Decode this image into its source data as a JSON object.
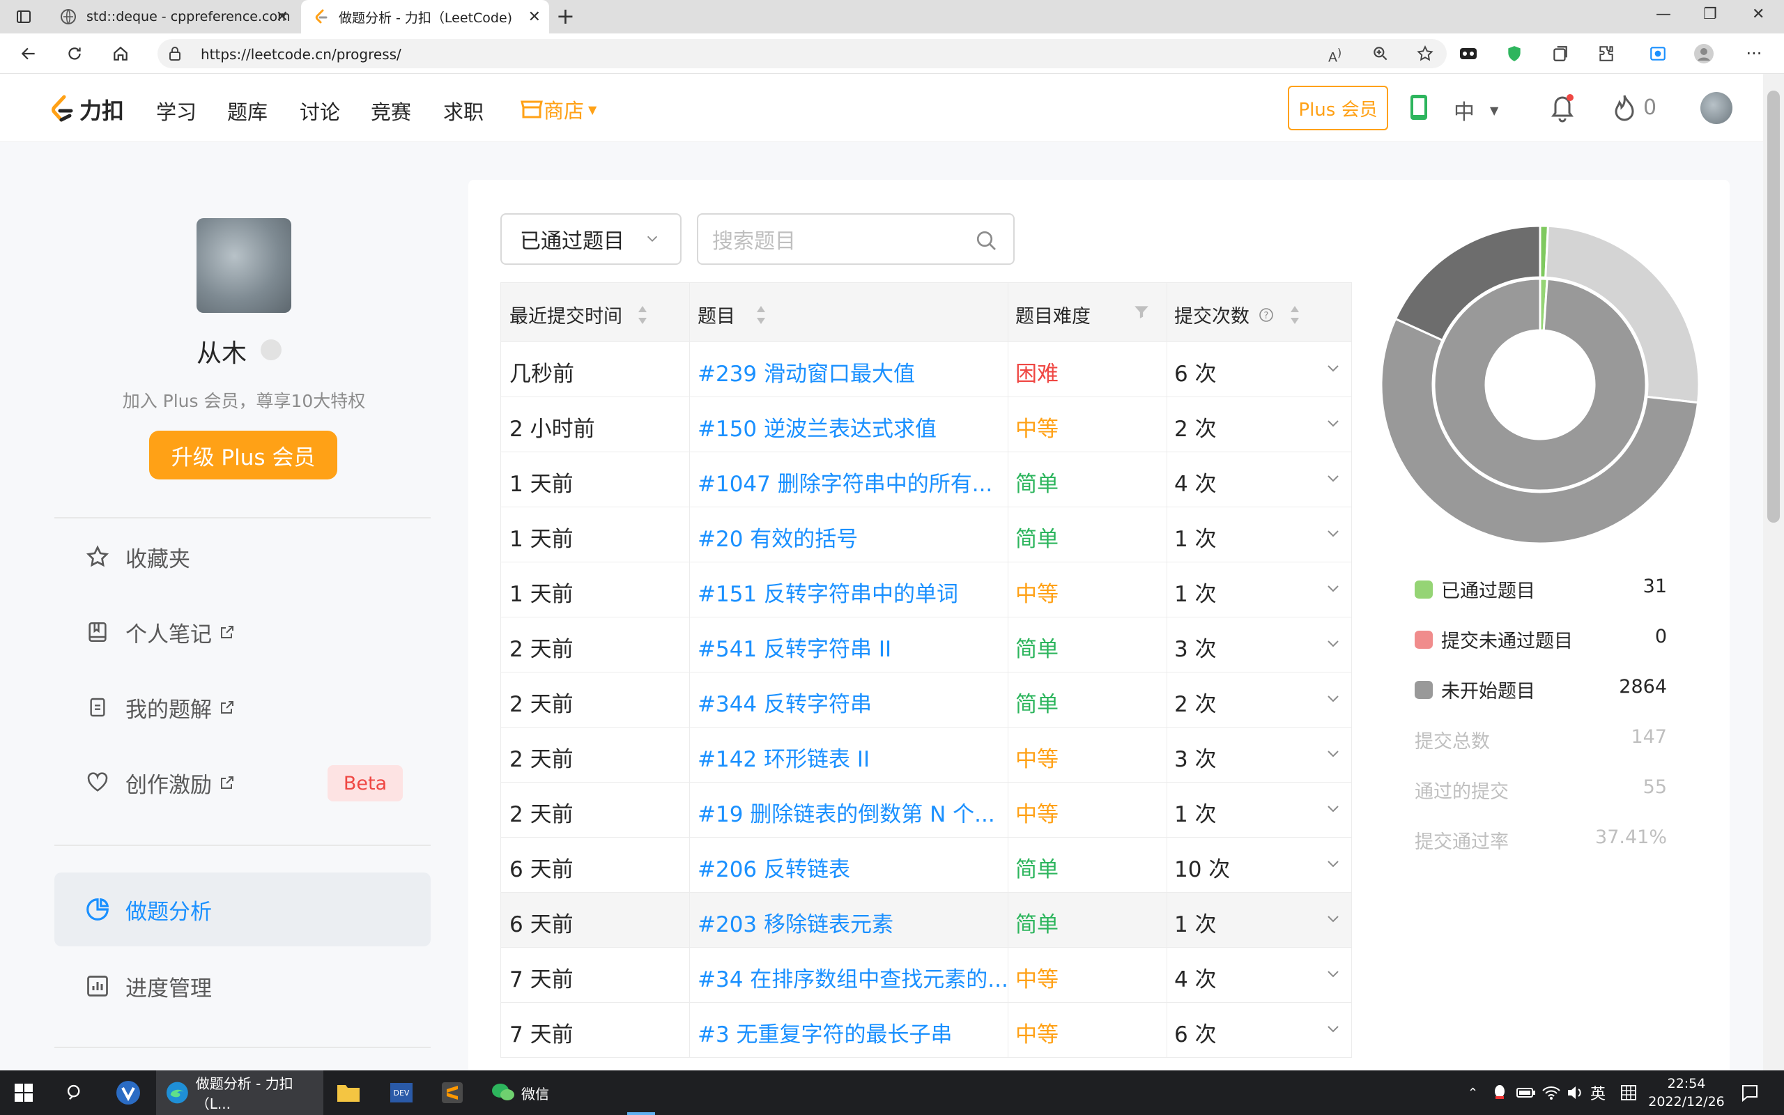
{
  "browser": {
    "tabs": [
      {
        "title": "std::deque - cppreference.com"
      },
      {
        "title": "做题分析 - 力扣（LeetCode)"
      }
    ],
    "url": "https://leetcode.cn/progress/"
  },
  "site": {
    "logo": "力扣",
    "nav": [
      "学习",
      "题库",
      "讨论",
      "竞赛",
      "求职"
    ],
    "store": "商店",
    "plus_button": "Plus 会员",
    "lang": "中",
    "streak": "0"
  },
  "profile": {
    "name": "从木",
    "plus_hint": "加入 Plus 会员，尊享10大特权",
    "upgrade_button": "升级 Plus 会员"
  },
  "sidebar": {
    "items": [
      {
        "label": "收藏夹",
        "icon": "star-icon"
      },
      {
        "label": "个人笔记",
        "icon": "notebook-icon"
      },
      {
        "label": "我的题解",
        "icon": "document-icon"
      },
      {
        "label": "创作激励",
        "icon": "heart-icon"
      },
      {
        "label": "做题分析",
        "icon": "pie-chart-icon"
      },
      {
        "label": "进度管理",
        "icon": "bar-chart-icon"
      }
    ],
    "beta": "Beta"
  },
  "filters": {
    "status": "已通过题目",
    "search_placeholder": "搜索题目"
  },
  "table": {
    "headers": [
      "最近提交时间",
      "题目",
      "题目难度",
      "提交次数"
    ],
    "rows": [
      {
        "time": "几秒前",
        "title": "#239 滑动窗口最大值",
        "difficulty": "困难",
        "count": "6 次"
      },
      {
        "time": "2 小时前",
        "title": "#150 逆波兰表达式求值",
        "difficulty": "中等",
        "count": "2 次"
      },
      {
        "time": "1 天前",
        "title": "#1047 删除字符串中的所有...",
        "difficulty": "简单",
        "count": "4 次"
      },
      {
        "time": "1 天前",
        "title": "#20 有效的括号",
        "difficulty": "简单",
        "count": "1 次"
      },
      {
        "time": "1 天前",
        "title": "#151 反转字符串中的单词",
        "difficulty": "中等",
        "count": "1 次"
      },
      {
        "time": "2 天前",
        "title": "#541 反转字符串 II",
        "difficulty": "简单",
        "count": "3 次"
      },
      {
        "time": "2 天前",
        "title": "#344 反转字符串",
        "difficulty": "简单",
        "count": "2 次"
      },
      {
        "time": "2 天前",
        "title": "#142 环形链表 II",
        "difficulty": "中等",
        "count": "3 次"
      },
      {
        "time": "2 天前",
        "title": "#19 删除链表的倒数第 N 个...",
        "difficulty": "中等",
        "count": "1 次"
      },
      {
        "time": "6 天前",
        "title": "#206 反转链表",
        "difficulty": "简单",
        "count": "10 次"
      },
      {
        "time": "6 天前",
        "title": "#203 移除链表元素",
        "difficulty": "简单",
        "count": "1 次"
      },
      {
        "time": "7 天前",
        "title": "#34 在排序数组中查找元素的...",
        "difficulty": "中等",
        "count": "4 次"
      },
      {
        "time": "7 天前",
        "title": "#3 无重复字符的最长子串",
        "difficulty": "中等",
        "count": "6 次"
      }
    ]
  },
  "stats": {
    "legend": [
      {
        "label": "已通过题目",
        "value": "31",
        "color": "#95d475"
      },
      {
        "label": "提交未通过题目",
        "value": "0",
        "color": "#f08c8c"
      },
      {
        "label": "未开始题目",
        "value": "2864",
        "color": "#999999"
      }
    ],
    "summary": [
      {
        "label": "提交总数",
        "value": "147"
      },
      {
        "label": "通过的提交",
        "value": "55"
      },
      {
        "label": "提交通过率",
        "value": "37.41%"
      }
    ]
  },
  "colors": {
    "accent": "#ffa116",
    "link": "#1a90ff",
    "hard": "#ef4743",
    "medium": "#ffa116",
    "easy": "#2db55d"
  },
  "taskbar": {
    "apps": [
      {
        "label": "做题分析 - 力扣（L..."
      },
      {
        "label": "微信"
      }
    ],
    "ime": "英",
    "time": "22:54",
    "date": "2022/12/26"
  }
}
